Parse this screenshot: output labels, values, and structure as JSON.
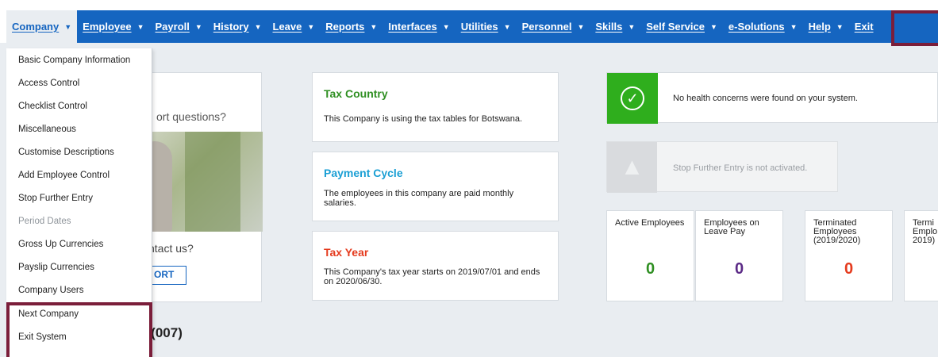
{
  "menu": {
    "items": [
      {
        "label": "Company",
        "chevron": true
      },
      {
        "label": "Employee",
        "chevron": true
      },
      {
        "label": "Payroll",
        "chevron": true
      },
      {
        "label": "History",
        "chevron": true
      },
      {
        "label": "Leave",
        "chevron": true
      },
      {
        "label": "Reports",
        "chevron": true
      },
      {
        "label": "Interfaces",
        "chevron": true
      },
      {
        "label": "Utilities",
        "chevron": true
      },
      {
        "label": "Personnel",
        "chevron": true
      },
      {
        "label": "Skills",
        "chevron": true
      },
      {
        "label": "Self Service",
        "chevron": true
      },
      {
        "label": "e-Solutions",
        "chevron": true
      },
      {
        "label": "Help",
        "chevron": true
      },
      {
        "label": "Exit",
        "chevron": false
      }
    ]
  },
  "dropdown": {
    "items": [
      {
        "label": "Basic Company Information",
        "disabled": false
      },
      {
        "label": "Access Control",
        "disabled": false
      },
      {
        "label": "Checklist Control",
        "disabled": false
      },
      {
        "label": "Miscellaneous",
        "disabled": false
      },
      {
        "label": "Customise Descriptions",
        "disabled": false
      },
      {
        "label": "Add Employee Control",
        "disabled": false
      },
      {
        "label": "Stop Further Entry",
        "disabled": false
      },
      {
        "label": "Period Dates",
        "disabled": true
      },
      {
        "label": "Gross Up Currencies",
        "disabled": false
      },
      {
        "label": "Payslip Currencies",
        "disabled": false
      },
      {
        "label": "Company Users",
        "disabled": false
      },
      {
        "label": "Next Company",
        "disabled": false
      },
      {
        "label": "Exit System",
        "disabled": false
      }
    ]
  },
  "support": {
    "question_fragment": "ort questions?",
    "contact_fragment": "ntact us?",
    "button_fragment": "ORT"
  },
  "cards": {
    "tax_country": {
      "title": "Tax Country",
      "text": "This Company is using the tax tables for Botswana."
    },
    "payment_cycle": {
      "title": "Payment Cycle",
      "text": "The employees in this company are paid monthly salaries."
    },
    "tax_year": {
      "title": "Tax Year",
      "text": "This Company's tax year starts on 2019/07/01 and ends on 2020/06/30."
    }
  },
  "health": {
    "message": "No health concerns were found on your system."
  },
  "stop_entry": {
    "message": "Stop Further Entry is not activated."
  },
  "stats": [
    {
      "label": "Active Employees",
      "value": "0",
      "color": "#2f8f22"
    },
    {
      "label": "Employees on Leave Pay",
      "value": "0",
      "color": "#5b2a86"
    },
    {
      "label": "Terminated Employees (2019/2020)",
      "value": "0",
      "color": "#e53b1e"
    },
    {
      "label": "Termi Emplo 2019)",
      "value": "",
      "color": "#222222"
    }
  ],
  "company_title_fragment": "e (007)",
  "colors": {
    "menu_bg": "#1565c0",
    "highlight": "#7b1e3a"
  }
}
